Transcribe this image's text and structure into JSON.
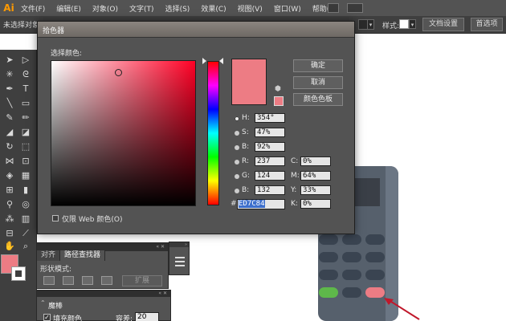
{
  "app": {
    "logo": "Ai",
    "menu": [
      "文件(F)",
      "编辑(E)",
      "对象(O)",
      "文字(T)",
      "选择(S)",
      "效果(C)",
      "视图(V)",
      "窗口(W)",
      "帮助(H)"
    ]
  },
  "control_bar": {
    "selection_status": "未选择对象",
    "style_label": "样式:",
    "doc_setup": "文档设置",
    "prefs": "首选项"
  },
  "color_picker": {
    "title": "拾色器",
    "label": "选择颜色:",
    "buttons": {
      "ok": "确定",
      "cancel": "取消",
      "swatches": "颜色色板"
    },
    "hsb": {
      "h_label": "H:",
      "h": "354°",
      "s_label": "S:",
      "s": "47%",
      "b_label": "B:",
      "b": "92%"
    },
    "rgb": {
      "r_label": "R:",
      "r": "237",
      "g_label": "G:",
      "g": "124",
      "b_label": "B:",
      "b": "132"
    },
    "cmyk": {
      "c_label": "C:",
      "c": "0%",
      "m_label": "M:",
      "m": "64%",
      "y_label": "Y:",
      "y": "33%",
      "k_label": "K:",
      "k": "0%"
    },
    "hex_label": "#",
    "hex": "ED7C84",
    "web_only": "仅限 Web 颜色(O)",
    "selected_color": "#ed7c84"
  },
  "pathfinder": {
    "tabs": [
      "对齐",
      "路径查找器"
    ],
    "mode_label": "形状模式:",
    "expand": "扩展"
  },
  "magic_wand": {
    "title": "魔棒",
    "fill_color": "填充颜色",
    "tolerance_label": "容差:",
    "tolerance": "20"
  },
  "colors": {
    "accent_pink": "#ed7c84",
    "key_green": "#5eb84a",
    "device_body": "#56606c",
    "annotation_arrow": "#c0182b"
  }
}
